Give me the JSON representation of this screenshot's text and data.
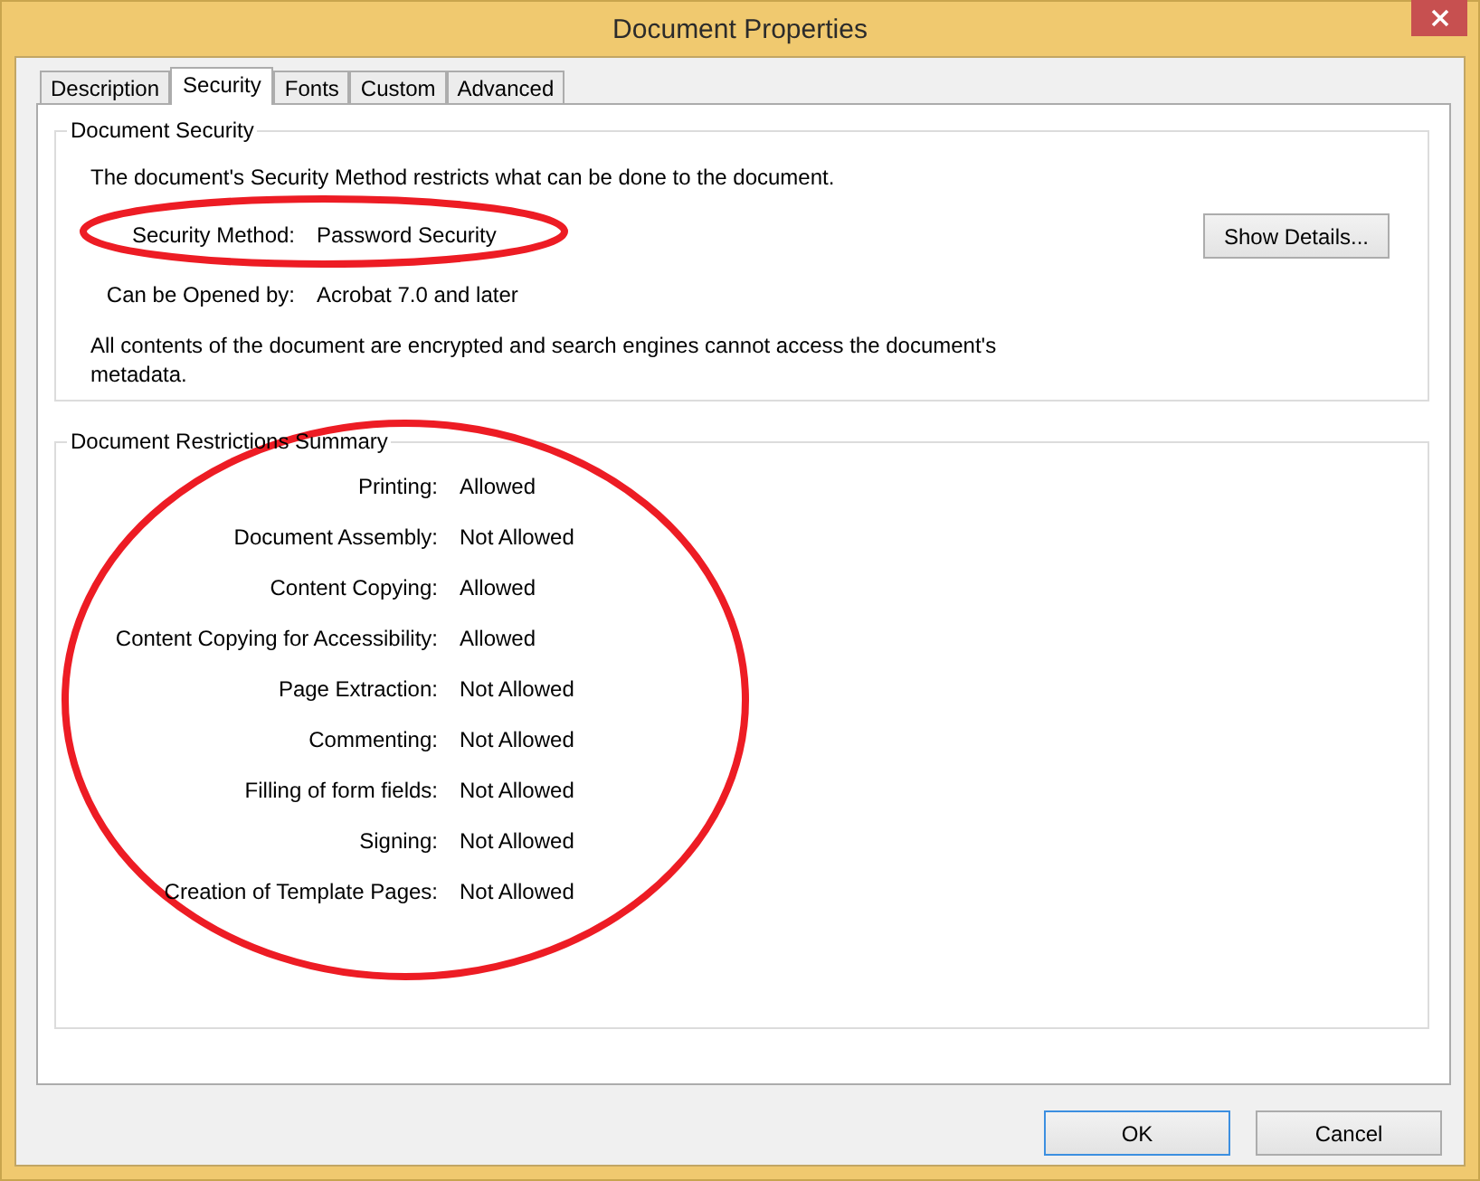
{
  "window": {
    "title": "Document Properties"
  },
  "tabs": [
    {
      "label": "Description",
      "selected": false
    },
    {
      "label": "Security",
      "selected": true
    },
    {
      "label": "Fonts",
      "selected": false
    },
    {
      "label": "Custom",
      "selected": false
    },
    {
      "label": "Advanced",
      "selected": false
    }
  ],
  "document_security": {
    "title": "Document Security",
    "intro": "The document's Security Method restricts what can be done to the document.",
    "fields": [
      {
        "label": "Security Method:",
        "value": "Password Security",
        "circled": true
      },
      {
        "label": "Can be Opened by:",
        "value": "Acrobat 7.0 and later",
        "circled": false
      }
    ],
    "show_details_button": "Show Details...",
    "note": "All contents of the document are encrypted and search engines cannot access the document's metadata."
  },
  "restrictions": {
    "title": "Document Restrictions Summary",
    "circled": true,
    "rows": [
      {
        "label": "Printing:",
        "value": "Allowed"
      },
      {
        "label": "Document Assembly:",
        "value": "Not Allowed"
      },
      {
        "label": "Content Copying:",
        "value": "Allowed"
      },
      {
        "label": "Content Copying for Accessibility:",
        "value": "Allowed"
      },
      {
        "label": "Page Extraction:",
        "value": "Not Allowed"
      },
      {
        "label": "Commenting:",
        "value": "Not Allowed"
      },
      {
        "label": "Filling of form fields:",
        "value": "Not Allowed"
      },
      {
        "label": "Signing:",
        "value": "Not Allowed"
      },
      {
        "label": "Creation of Template Pages:",
        "value": "Not Allowed"
      }
    ]
  },
  "buttons": [
    {
      "label": "OK",
      "default": true
    },
    {
      "label": "Cancel",
      "default": false
    }
  ]
}
